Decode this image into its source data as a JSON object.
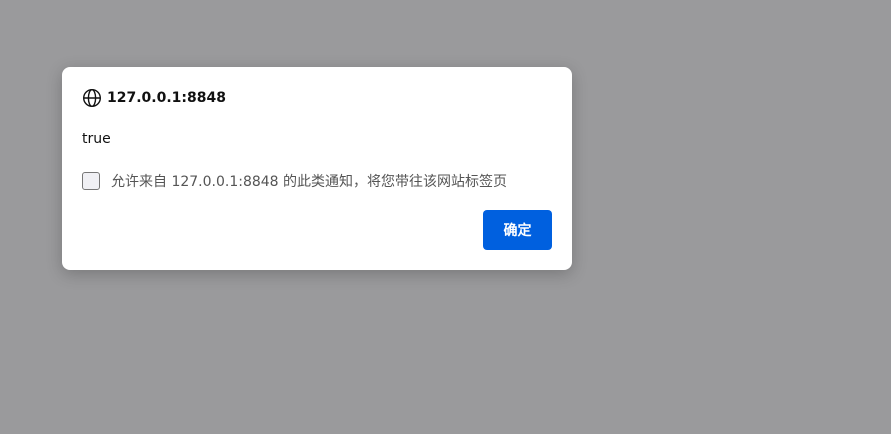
{
  "dialog": {
    "origin": "127.0.0.1:8848",
    "origin_icon": "globe-icon",
    "message": "true",
    "checkbox": {
      "checked": false,
      "label": "允许来自 127.0.0.1:8848 的此类通知，将您带往该网站标签页"
    },
    "ok_label": "确定"
  },
  "colors": {
    "backdrop": "#9a9a9c",
    "dialog_bg": "#ffffff",
    "primary_button": "#0060df"
  }
}
